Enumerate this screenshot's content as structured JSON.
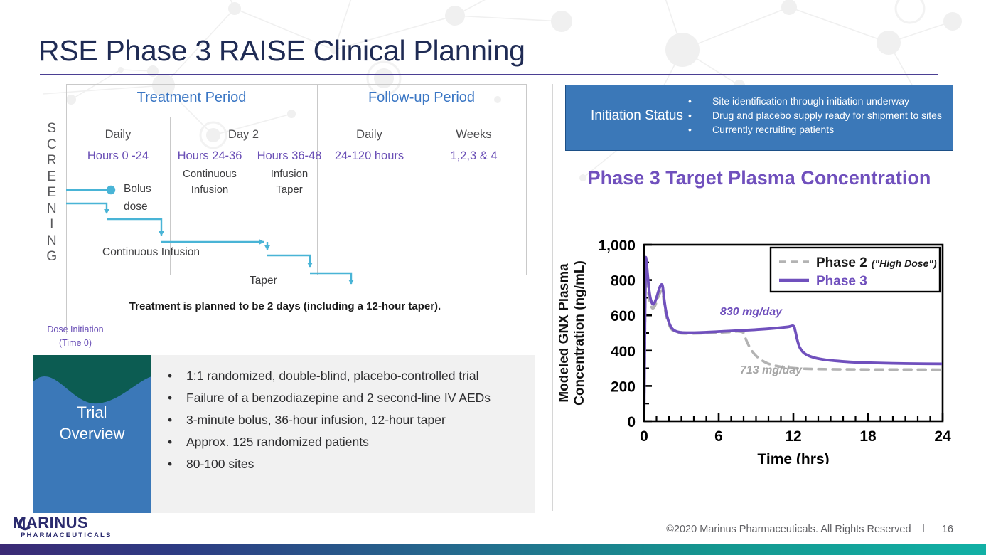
{
  "title": "RSE Phase 3 RAISE Clinical Planning",
  "screening": {
    "label": "SCREENING"
  },
  "timeline": {
    "periods": [
      {
        "label": "Treatment Period"
      },
      {
        "label": "Follow-up Period"
      }
    ],
    "columns": [
      {
        "day": "Daily",
        "hours": "Hours 0 -24",
        "sub": ""
      },
      {
        "day": "Day 2",
        "hours": "Hours 24-36",
        "sub": "Continuous\nInfusion"
      },
      {
        "day": "",
        "hours": "Hours 36-48",
        "sub": "Infusion\nTaper"
      },
      {
        "day": "Daily",
        "hours": "24-120 hours",
        "sub": ""
      },
      {
        "day": "Weeks",
        "hours": "1,2,3 & 4",
        "sub": ""
      }
    ],
    "day2_label": "Day 2",
    "steps": {
      "bolus": "Bolus",
      "bolus_dose": "dose",
      "continuous_infusion": "Continuous Infusion",
      "taper": "Taper"
    },
    "note": "Treatment is planned to be 2 days (including a 12-hour taper).",
    "dose_initiation_line1": "Dose Initiation",
    "dose_initiation_line2": "(Time 0)"
  },
  "trial_overview": {
    "badge_line1": "Trial",
    "badge_line2": "Overview",
    "bullet_glyph": "•",
    "bullets": [
      "1:1 randomized, double-blind, placebo-controlled trial",
      "Failure of a benzodiazepine and 2 second-line IV AEDs",
      "3-minute bolus, 36-hour infusion, 12-hour taper",
      "Approx. 125 randomized patients",
      "80-100 sites"
    ]
  },
  "initiation_status": {
    "title": "Initiation Status",
    "bullet_glyph": "•",
    "bullets": [
      "Site identification through initiation underway",
      "Drug and placebo supply ready for shipment to sites",
      "Currently recruiting patients"
    ]
  },
  "chart_data": {
    "type": "line",
    "title": "Phase 3 Target Plasma Concentration",
    "xlabel": "Time (hrs)",
    "ylabel": "Modeled GNX Plasma Concentration (ng/mL)",
    "ylabel_line1": "Modeled GNX Plasma",
    "ylabel_line2": "Concentration (ng/mL)",
    "xlim": [
      0,
      24
    ],
    "ylim": [
      0,
      1000
    ],
    "xticks": [
      0,
      6,
      12,
      18,
      24
    ],
    "xtick_labels": [
      "0",
      "6",
      "12",
      "18",
      "24"
    ],
    "yticks": [
      0,
      200,
      400,
      600,
      800,
      1000
    ],
    "ytick_labels": [
      "0",
      "200",
      "400",
      "600",
      "800",
      "1,000"
    ],
    "x_minor_step": 1,
    "y_minor_step": 100,
    "grid": false,
    "legend_position": "top-right",
    "legend": [
      {
        "label": "Phase 2",
        "suffix": "(\"High Dose\")",
        "style": "dashed",
        "color": "#b3b3b3",
        "text_color": "#1a1a1a"
      },
      {
        "label": "Phase 3",
        "suffix": "",
        "style": "solid",
        "color": "#7050bd",
        "text_color": "#7050bd"
      }
    ],
    "annotations": [
      {
        "text": "830 mg/day",
        "x": 8.6,
        "y": 600,
        "color": "#7050bd"
      },
      {
        "text": "713 mg/day",
        "x": 10.2,
        "y": 270,
        "color": "#a6a6a6"
      }
    ],
    "series": [
      {
        "name": "Phase 3",
        "color": "#7050bd",
        "style": "solid",
        "dose": "830 mg/day",
        "points": [
          [
            0.0,
            0
          ],
          [
            0.06,
            480
          ],
          [
            0.12,
            880
          ],
          [
            0.17,
            920
          ],
          [
            0.25,
            860
          ],
          [
            0.38,
            760
          ],
          [
            0.5,
            700
          ],
          [
            0.62,
            672
          ],
          [
            0.72,
            662
          ],
          [
            0.85,
            672
          ],
          [
            1.0,
            700
          ],
          [
            1.15,
            735
          ],
          [
            1.3,
            765
          ],
          [
            1.42,
            775
          ],
          [
            1.5,
            762
          ],
          [
            1.6,
            700
          ],
          [
            1.75,
            628
          ],
          [
            1.95,
            570
          ],
          [
            2.2,
            530
          ],
          [
            2.5,
            512
          ],
          [
            2.9,
            504
          ],
          [
            3.4,
            502
          ],
          [
            4.5,
            503
          ],
          [
            6.0,
            508
          ],
          [
            8.0,
            515
          ],
          [
            10.0,
            524
          ],
          [
            11.5,
            534
          ],
          [
            12.0,
            540
          ],
          [
            12.15,
            512
          ],
          [
            12.3,
            465
          ],
          [
            12.5,
            420
          ],
          [
            12.8,
            390
          ],
          [
            13.2,
            372
          ],
          [
            13.8,
            358
          ],
          [
            14.6,
            348
          ],
          [
            15.6,
            341
          ],
          [
            16.8,
            335
          ],
          [
            18.2,
            331
          ],
          [
            20.0,
            328
          ],
          [
            22.0,
            326
          ],
          [
            24.0,
            325
          ]
        ]
      },
      {
        "name": "Phase 2 (\"High Dose\")",
        "color": "#b3b3b3",
        "style": "dashed",
        "dose": "713 mg/day",
        "points": [
          [
            0.0,
            0
          ],
          [
            0.06,
            430
          ],
          [
            0.12,
            800
          ],
          [
            0.17,
            840
          ],
          [
            0.25,
            790
          ],
          [
            0.38,
            710
          ],
          [
            0.5,
            665
          ],
          [
            0.62,
            645
          ],
          [
            0.72,
            640
          ],
          [
            0.85,
            650
          ],
          [
            1.0,
            676
          ],
          [
            1.15,
            706
          ],
          [
            1.3,
            730
          ],
          [
            1.42,
            740
          ],
          [
            1.5,
            728
          ],
          [
            1.6,
            672
          ],
          [
            1.75,
            608
          ],
          [
            1.95,
            556
          ],
          [
            2.2,
            522
          ],
          [
            2.5,
            506
          ],
          [
            2.9,
            499
          ],
          [
            3.4,
            497
          ],
          [
            4.5,
            498
          ],
          [
            6.0,
            502
          ],
          [
            7.0,
            506
          ],
          [
            7.6,
            509
          ],
          [
            8.0,
            500
          ],
          [
            8.2,
            462
          ],
          [
            8.5,
            418
          ],
          [
            8.9,
            378
          ],
          [
            9.4,
            348
          ],
          [
            10.0,
            326
          ],
          [
            10.8,
            311
          ],
          [
            11.8,
            302
          ],
          [
            13.0,
            297
          ],
          [
            14.5,
            295
          ],
          [
            16.5,
            294
          ],
          [
            19.0,
            293
          ],
          [
            21.5,
            293
          ],
          [
            24.0,
            292
          ]
        ]
      }
    ]
  },
  "footer": {
    "copyright": "©2020 Marinus Pharmaceuticals. All Rights Reserved",
    "separator": "l",
    "page_number": "16",
    "logo_name": "MARINUS",
    "logo_sub": "PHARMACEUTICALS"
  }
}
